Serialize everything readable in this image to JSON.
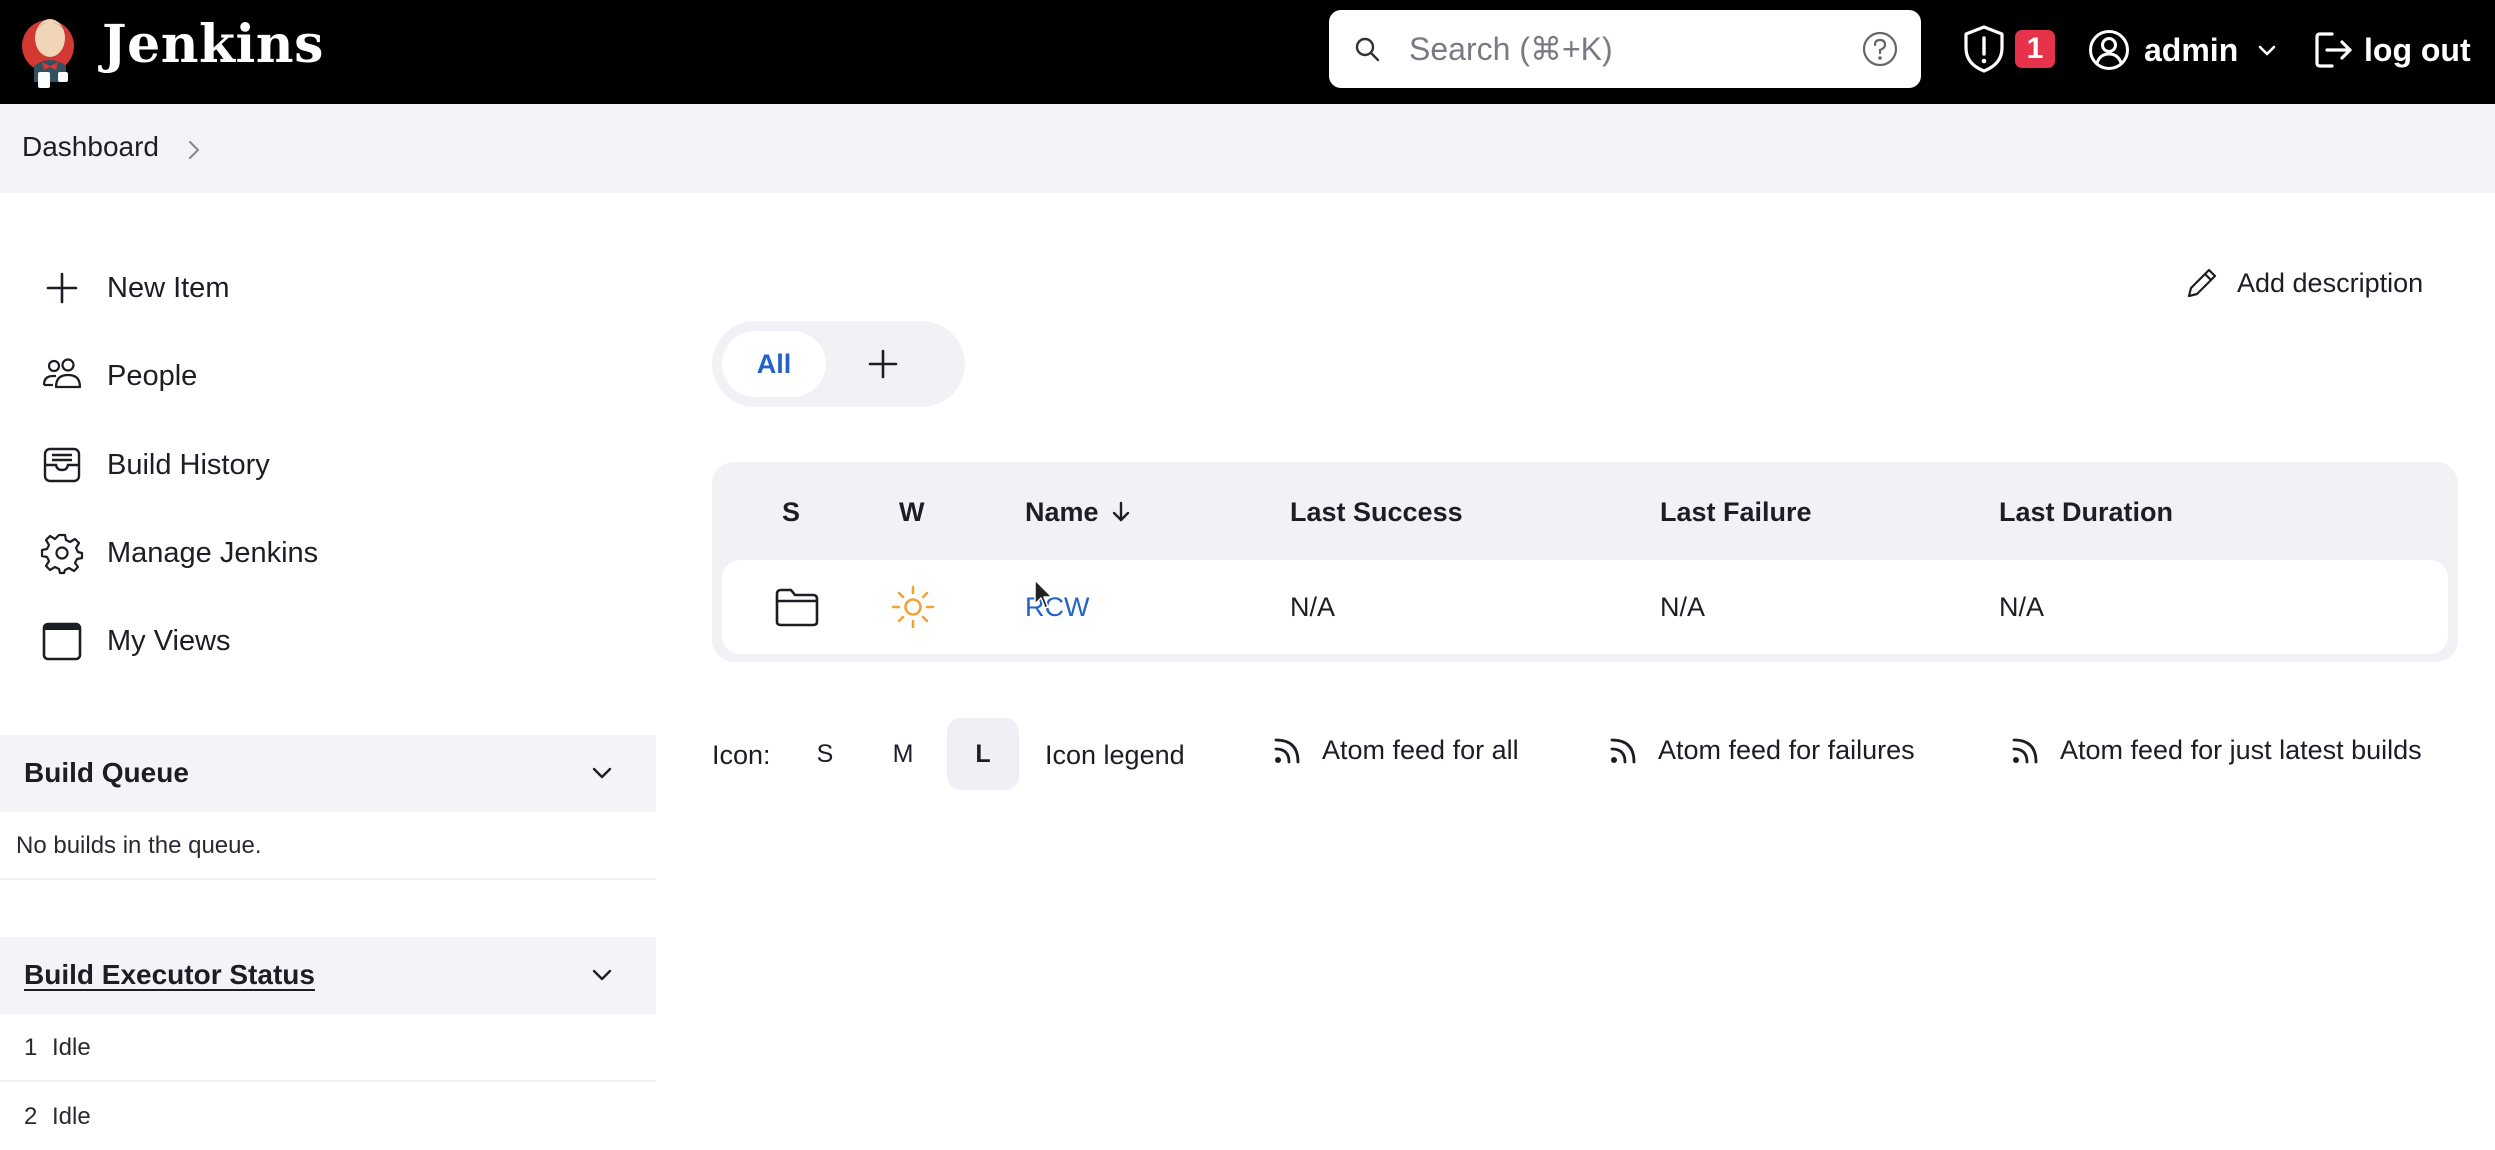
{
  "header": {
    "brand": "Jenkins",
    "search_placeholder": "Search (⌘+K)",
    "security_badge_count": "1",
    "user_name": "admin",
    "logout_label": "log out",
    "badge_color": "#e6324b"
  },
  "breadcrumb": {
    "items": [
      "Dashboard"
    ]
  },
  "sidebar": {
    "items": [
      {
        "label": "New Item",
        "icon": "plus-icon"
      },
      {
        "label": "People",
        "icon": "people-icon"
      },
      {
        "label": "Build History",
        "icon": "build-history-icon"
      },
      {
        "label": "Manage Jenkins",
        "icon": "gear-icon"
      },
      {
        "label": "My Views",
        "icon": "window-icon"
      }
    ],
    "build_queue": {
      "title": "Build Queue",
      "empty_text": "No builds in the queue."
    },
    "executor_status": {
      "title": "Build Executor Status",
      "executors": [
        {
          "number": "1",
          "status": "Idle"
        },
        {
          "number": "2",
          "status": "Idle"
        }
      ]
    }
  },
  "main": {
    "add_description_label": "Add description",
    "tabs": [
      {
        "label": "All",
        "active": true
      }
    ],
    "accent_color": "#2362c9",
    "table": {
      "columns": [
        "S",
        "W",
        "Name",
        "Last Success",
        "Last Failure",
        "Last Duration"
      ],
      "sort_column": "Name",
      "sort_direction": "descending",
      "rows": [
        {
          "status_icon": "folder-icon",
          "weather_icon": "sun-icon",
          "name": "RCW",
          "last_success": "N/A",
          "last_failure": "N/A",
          "last_duration": "N/A"
        }
      ]
    },
    "icon_size": {
      "label": "Icon:",
      "options": [
        "S",
        "M",
        "L"
      ],
      "selected": "L"
    },
    "icon_legend_label": "Icon legend",
    "feeds": [
      "Atom feed for all",
      "Atom feed for failures",
      "Atom feed for just latest builds"
    ]
  }
}
